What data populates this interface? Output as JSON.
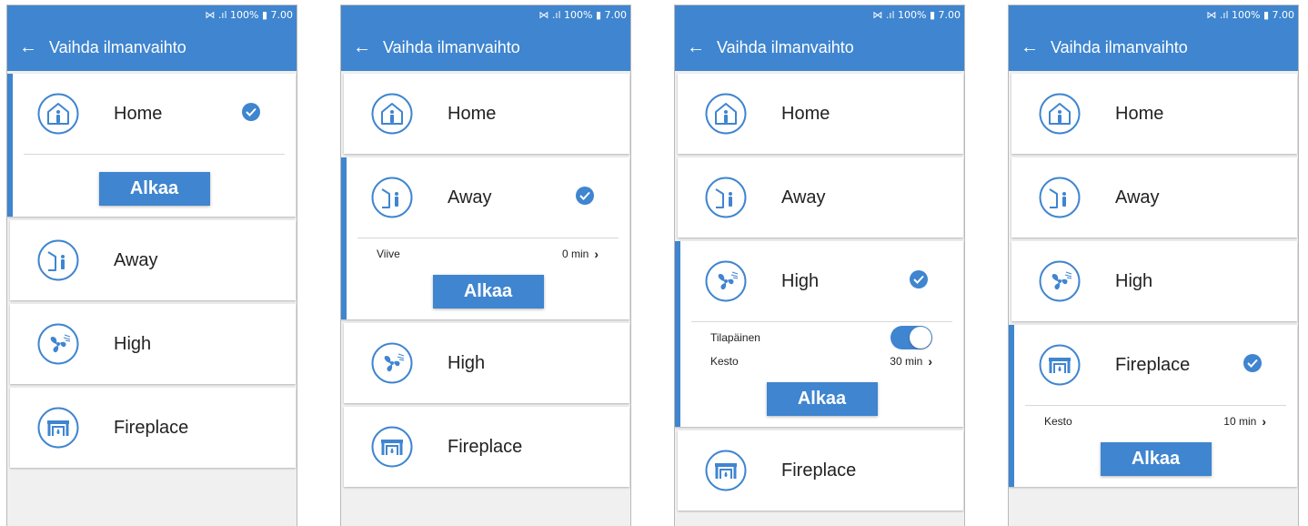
{
  "colors": {
    "accent": "#3f85d0",
    "background": "#f0f0f0"
  },
  "status_bar": {
    "text": "὏6 100% ▮ 7.00",
    "battery": "100%",
    "time": "7.00"
  },
  "app_bar": {
    "title": "Vaihda ilmanvaihto",
    "back_icon": "arrow-left-icon"
  },
  "screens": [
    {
      "selected_mode": "Home",
      "modes": [
        {
          "label": "Home",
          "icon": "home-icon"
        },
        {
          "label": "Away",
          "icon": "away-icon"
        },
        {
          "label": "High",
          "icon": "fan-icon"
        },
        {
          "label": "Fireplace",
          "icon": "fireplace-icon"
        }
      ],
      "details": [],
      "start_label": "Alkaa"
    },
    {
      "selected_mode": "Away",
      "modes": [
        {
          "label": "Home",
          "icon": "home-icon"
        },
        {
          "label": "Away",
          "icon": "away-icon"
        },
        {
          "label": "High",
          "icon": "fan-icon"
        },
        {
          "label": "Fireplace",
          "icon": "fireplace-icon"
        }
      ],
      "details": [
        {
          "label": "Viive",
          "value": "0 min"
        }
      ],
      "start_label": "Alkaa"
    },
    {
      "selected_mode": "High",
      "modes": [
        {
          "label": "Home",
          "icon": "home-icon"
        },
        {
          "label": "Away",
          "icon": "away-icon"
        },
        {
          "label": "High",
          "icon": "fan-icon"
        },
        {
          "label": "Fireplace",
          "icon": "fireplace-icon"
        }
      ],
      "details": [
        {
          "label": "Tilapäinen",
          "toggle": true
        },
        {
          "label": "Kesto",
          "value": "30 min"
        }
      ],
      "start_label": "Alkaa"
    },
    {
      "selected_mode": "Fireplace",
      "modes": [
        {
          "label": "Home",
          "icon": "home-icon"
        },
        {
          "label": "Away",
          "icon": "away-icon"
        },
        {
          "label": "High",
          "icon": "fan-icon"
        },
        {
          "label": "Fireplace",
          "icon": "fireplace-icon"
        }
      ],
      "details": [
        {
          "label": "Kesto",
          "value": "10 min"
        }
      ],
      "start_label": "Alkaa"
    }
  ]
}
